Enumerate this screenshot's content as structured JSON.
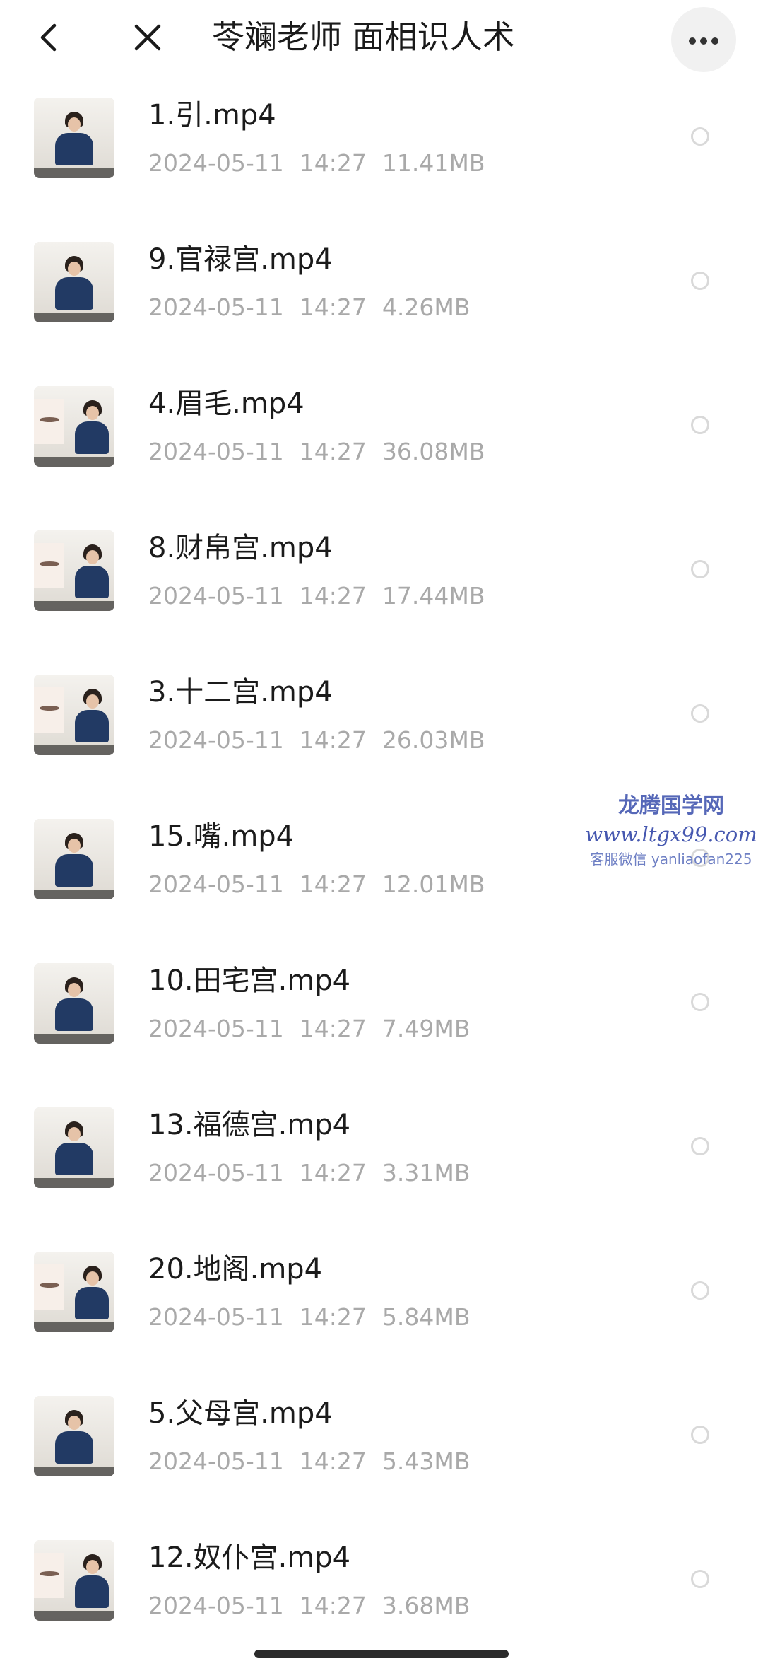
{
  "header": {
    "title": "苓斓老师 面相识人术",
    "back_icon": "chevron-left-icon",
    "close_icon": "close-icon",
    "more_icon": "more-horizontal-icon"
  },
  "files": [
    {
      "name": "1.引.mp4",
      "date": "2024-05-11",
      "time": "14:27",
      "size": "11.41MB",
      "thumb": "person"
    },
    {
      "name": "9.官禄宫.mp4",
      "date": "2024-05-11",
      "time": "14:27",
      "size": "4.26MB",
      "thumb": "person"
    },
    {
      "name": "4.眉毛.mp4",
      "date": "2024-05-11",
      "time": "14:27",
      "size": "36.08MB",
      "thumb": "person-with-eyebrow-inset"
    },
    {
      "name": "8.财帛宫.mp4",
      "date": "2024-05-11",
      "time": "14:27",
      "size": "17.44MB",
      "thumb": "person-with-nose-inset"
    },
    {
      "name": "3.十二宫.mp4",
      "date": "2024-05-11",
      "time": "14:27",
      "size": "26.03MB",
      "thumb": "person-with-face-chart-inset"
    },
    {
      "name": "15.嘴.mp4",
      "date": "2024-05-11",
      "time": "14:27",
      "size": "12.01MB",
      "thumb": "person"
    },
    {
      "name": "10.田宅宫.mp4",
      "date": "2024-05-11",
      "time": "14:27",
      "size": "7.49MB",
      "thumb": "person"
    },
    {
      "name": "13.福德宫.mp4",
      "date": "2024-05-11",
      "time": "14:27",
      "size": "3.31MB",
      "thumb": "person"
    },
    {
      "name": "20.地阁.mp4",
      "date": "2024-05-11",
      "time": "14:27",
      "size": "5.84MB",
      "thumb": "person-with-face-sketch-inset"
    },
    {
      "name": "5.父母宫.mp4",
      "date": "2024-05-11",
      "time": "14:27",
      "size": "5.43MB",
      "thumb": "person"
    },
    {
      "name": "12.奴仆宫.mp4",
      "date": "2024-05-11",
      "time": "14:27",
      "size": "3.68MB",
      "thumb": "person-with-photo-inset"
    }
  ],
  "watermark": {
    "title": "龙腾国学网",
    "url": "www.ltgx99.com",
    "contact": "客服微信 yanliaofan225"
  },
  "colors": {
    "background": "#ffffff",
    "file_name": "#1b1b1b",
    "meta_text": "#a9a9a9",
    "radio_border": "#d9d9d9",
    "watermark": "#5668b8"
  }
}
